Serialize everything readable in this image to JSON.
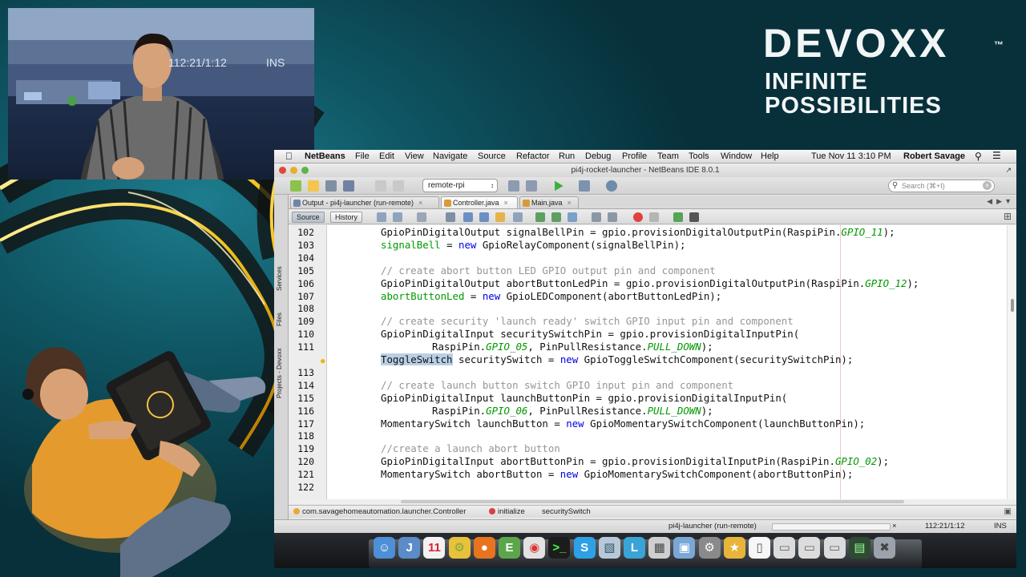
{
  "branding": {
    "logo": "DEVOXX",
    "logo_accent": "X",
    "trademark": "™",
    "tagline_1": "INFINITE",
    "tagline_2": "POSSIBILITIES",
    "accent_color": "#f5a800"
  },
  "speaker_video": {
    "status_position": "112:21/1:12",
    "status_mode": "INS"
  },
  "menubar": {
    "app_name": "NetBeans",
    "items": [
      "File",
      "Edit",
      "View",
      "Navigate",
      "Source",
      "Refactor",
      "Run",
      "Debug",
      "Profile",
      "Team",
      "Tools",
      "Window",
      "Help"
    ],
    "clock": "Tue Nov 11  3:10 PM",
    "user": "Robert Savage"
  },
  "window": {
    "title": "pi4j-rocket-launcher - NetBeans IDE 8.0.1"
  },
  "toolbar": {
    "config_value": "remote-rpi",
    "search_placeholder": "Search (⌘+I)"
  },
  "tabs": [
    {
      "label": "Output - pi4j-launcher (run-remote)",
      "active": false
    },
    {
      "label": "Controller.java",
      "active": true
    },
    {
      "label": "Main.java",
      "active": false
    }
  ],
  "side_tabs": [
    "Services",
    "Files",
    "Projects - Devoxx"
  ],
  "editor_toolbar": {
    "source_label": "Source",
    "history_label": "History"
  },
  "code_lines": [
    {
      "n": "102",
      "html": "GpioPinDigitalOutput signalBellPin = gpio.provisionDigitalOutputPin(RaspiPin.<span class=\"cst\">GPIO_11</span>);"
    },
    {
      "n": "103",
      "html": "<span class=\"fld\">signalBell</span> = <span class=\"kw\">new</span> GpioRelayComponent(signalBellPin);"
    },
    {
      "n": "104",
      "html": ""
    },
    {
      "n": "105",
      "html": "<span class=\"cm\">// create abort button LED GPIO output pin and component</span>"
    },
    {
      "n": "106",
      "html": "GpioPinDigitalOutput abortButtonLedPin = gpio.provisionDigitalOutputPin(RaspiPin.<span class=\"cst\">GPIO_12</span>);"
    },
    {
      "n": "107",
      "html": "<span class=\"fld\">abortButtonLed</span> = <span class=\"kw\">new</span> GpioLEDComponent(abortButtonLedPin);"
    },
    {
      "n": "108",
      "html": ""
    },
    {
      "n": "109",
      "html": "<span class=\"cm\">// create security 'launch ready' switch GPIO input pin and component</span>"
    },
    {
      "n": "110",
      "html": "GpioPinDigitalInput securitySwitchPin = gpio.provisionDigitalInputPin("
    },
    {
      "n": "111",
      "html": "RaspiPin.<span class=\"cst\">GPIO_05</span>, PinPullResistance.<span class=\"cst\">PULL_DOWN</span>);",
      "indent": true
    },
    {
      "n": "",
      "html": "<span class=\"sel\">ToggleSwitch</span> securitySwitch = <span class=\"kw\">new</span> GpioToggleSwitchComponent(securitySwitchPin);",
      "bulb": true
    },
    {
      "n": "113",
      "html": ""
    },
    {
      "n": "114",
      "html": "<span class=\"cm\">// create launch button switch GPIO input pin and component</span>"
    },
    {
      "n": "115",
      "html": "GpioPinDigitalInput launchButtonPin = gpio.provisionDigitalInputPin("
    },
    {
      "n": "116",
      "html": "RaspiPin.<span class=\"cst\">GPIO_06</span>, PinPullResistance.<span class=\"cst\">PULL_DOWN</span>);",
      "indent": true
    },
    {
      "n": "117",
      "html": "MomentarySwitch launchButton = <span class=\"kw\">new</span> GpioMomentarySwitchComponent(launchButtonPin);"
    },
    {
      "n": "118",
      "html": ""
    },
    {
      "n": "119",
      "html": "<span class=\"cm\">//create a launch abort button</span>"
    },
    {
      "n": "120",
      "html": "GpioPinDigitalInput abortButtonPin = gpio.provisionDigitalInputPin(RaspiPin.<span class=\"cst\">GPIO_02</span>);"
    },
    {
      "n": "121",
      "html": "MomentarySwitch abortButton = <span class=\"kw\">new</span> GpioMomentarySwitchComponent(abortButtonPin);"
    },
    {
      "n": "122",
      "html": ""
    }
  ],
  "breadcrumb": {
    "class": "com.savagehomeautomation.launcher.Controller",
    "method": "initialize",
    "field": "securitySwitch"
  },
  "statusbar": {
    "task": "pi4j-launcher (run-remote)",
    "progress_fraction": 0.0,
    "position": "112:21/1:12",
    "mode": "INS"
  },
  "dock": {
    "icons": [
      "finder-icon",
      "netbeans-icon",
      "calendar-icon",
      "utility-icon",
      "firefox-icon",
      "evernote-icon",
      "chrome-icon",
      "terminal-icon",
      "skype-icon",
      "preview-icon",
      "lync-icon",
      "dashboard-icon",
      "virtualbox-icon",
      "system-preferences-icon",
      "growl-icon",
      "document-icon",
      "window-icon",
      "window-icon",
      "window-icon",
      "screenshot-icon",
      "trash-icon"
    ]
  },
  "colors": {
    "keyword": "#0000e6",
    "comment": "#969696",
    "field": "#009900",
    "selection": "#b8cfe5",
    "margin_line": "#f3c6c6"
  }
}
